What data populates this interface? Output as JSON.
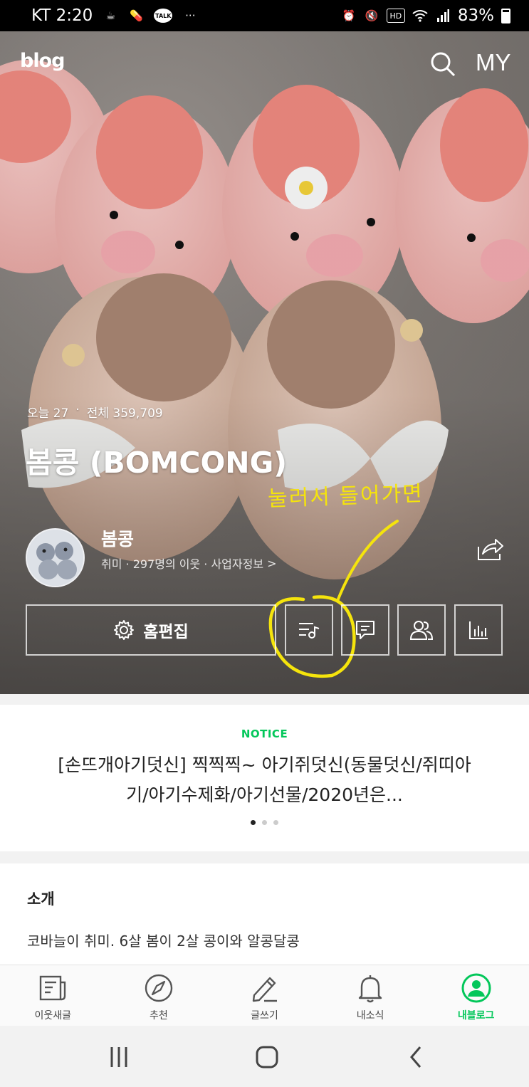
{
  "status_bar": {
    "carrier_time": "KT 2:20",
    "battery": "83%"
  },
  "header": {
    "logo": "blog",
    "my_label": "MY"
  },
  "hero": {
    "stats": {
      "today_label": "오늘 27",
      "separator": "·",
      "total_label": "전체 359,709"
    },
    "blog_title": "봄콩 (BOMCONG)",
    "annotation": "눌러서 들어가면",
    "owner_name": "봄콩",
    "owner_meta": "취미 · 297명의 이웃 · 사업자정보",
    "owner_meta_arrow": ">",
    "edit_label": "홈편집"
  },
  "notice": {
    "label": "NOTICE",
    "text": "[손뜨개아기덧신] 찍찍찍~ 아기쥐덧신(동물덧신/쥐띠아기/아기수제화/아기선물/2020년은...",
    "dot_count": 3,
    "active_dot": 0
  },
  "intro": {
    "title": "소개",
    "text": "코바늘이 취미. 6살 봄이 2살 콩이와 알콩달콩"
  },
  "tabs": [
    {
      "label": "이웃새글",
      "icon": "news-icon",
      "active": false
    },
    {
      "label": "추천",
      "icon": "compass-icon",
      "active": false
    },
    {
      "label": "글쓰기",
      "icon": "pencil-icon",
      "active": false
    },
    {
      "label": "내소식",
      "icon": "bell-icon",
      "active": false
    },
    {
      "label": "내블로그",
      "icon": "profile-icon",
      "active": true
    }
  ],
  "colors": {
    "accent": "#03c75a",
    "annotation": "#f5e40c"
  }
}
